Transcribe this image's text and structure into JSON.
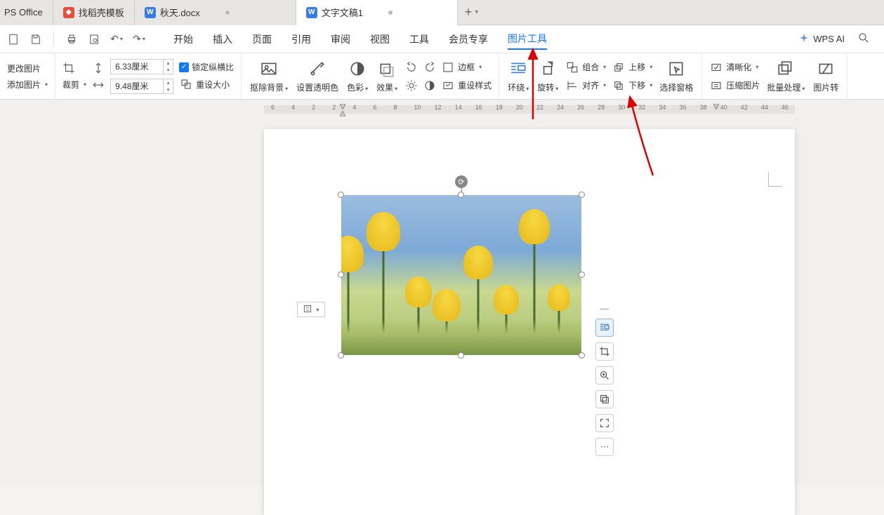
{
  "tabs": {
    "app": "PS Office",
    "t1": "找稻壳模板",
    "t2": "秋天.docx",
    "t3": "文字文稿1"
  },
  "menu": {
    "items": [
      "开始",
      "插入",
      "页面",
      "引用",
      "审阅",
      "视图",
      "工具",
      "会员专享",
      "图片工具"
    ],
    "active_index": 8,
    "ai": "WPS AI"
  },
  "ribbon": {
    "change_pic": "更改图片",
    "add_pic": "添加图片",
    "crop": "裁剪",
    "h_val": "6.33厘米",
    "w_val": "9.48厘米",
    "lock_ratio": "锁定纵横比",
    "reset_size": "重设大小",
    "remove_bg": "抠除背景",
    "set_trans": "设置透明色",
    "color": "色彩",
    "effect": "效果",
    "border": "边框",
    "reset_style": "重设样式",
    "wrap": "环绕",
    "rotate": "旋转",
    "group": "组合",
    "align": "对齐",
    "up": "上移",
    "down": "下移",
    "sel_pane": "选择窗格",
    "clarity": "清晰化",
    "compress": "压缩图片",
    "batch": "批量处理",
    "convert": "图片转"
  },
  "ruler": {
    "nums": [
      "6",
      "4",
      "2",
      "2",
      "4",
      "6",
      "8",
      "10",
      "12",
      "14",
      "16",
      "18",
      "20",
      "22",
      "24",
      "26",
      "28",
      "30",
      "32",
      "34",
      "36",
      "38",
      "40",
      "42",
      "44",
      "46"
    ]
  },
  "side_icons": [
    "minus",
    "wrap",
    "crop",
    "zoom",
    "clone",
    "expand",
    "more"
  ]
}
